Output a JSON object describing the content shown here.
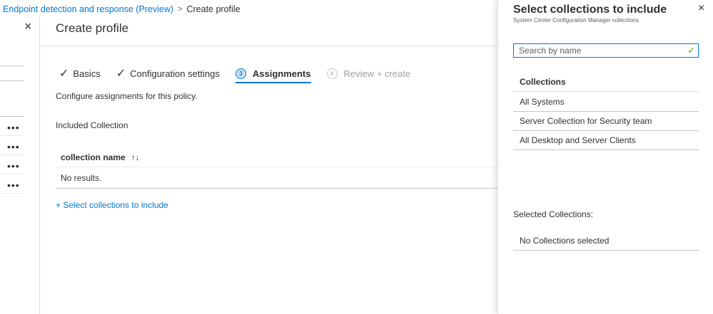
{
  "breadcrumb": {
    "parent": "Endpoint detection and response (Preview)",
    "separator": ">",
    "current": "Create profile"
  },
  "left_panel": {
    "close_icon": "×",
    "row_menu_icon": "•••"
  },
  "main": {
    "title": "Create profile",
    "steps": [
      {
        "number": "",
        "label": "Basics",
        "state": "completed",
        "icon": "checkmark-icon"
      },
      {
        "number": "",
        "label": "Configuration settings",
        "state": "completed",
        "icon": "checkmark-icon"
      },
      {
        "number": "3",
        "label": "Assignments",
        "state": "active"
      },
      {
        "number": "4",
        "label": "Review + create",
        "state": "disabled"
      }
    ],
    "description": "Configure assignments for this policy.",
    "included_heading": "Included Collection",
    "table": {
      "column_header": "collection name",
      "sort_icon": "↑↓",
      "empty_text": "No results."
    },
    "select_link": "+ Select collections to include"
  },
  "blade": {
    "title": "Select collections to include",
    "subtitle": "System Center Configuration Manager collections",
    "close_icon": "×",
    "search_placeholder": "Search by name",
    "search_valid_icon": "✓",
    "collections_header": "Collections",
    "collections": [
      "All Systems",
      "Server Collection for Security team",
      "All Desktop and Server Clients"
    ],
    "selected_label": "Selected Collections:",
    "selected_value": "No Collections selected"
  },
  "colors": {
    "accent": "#0078d4",
    "text": "#323130",
    "disabled": "#a19f9d",
    "valid": "#57a300"
  }
}
